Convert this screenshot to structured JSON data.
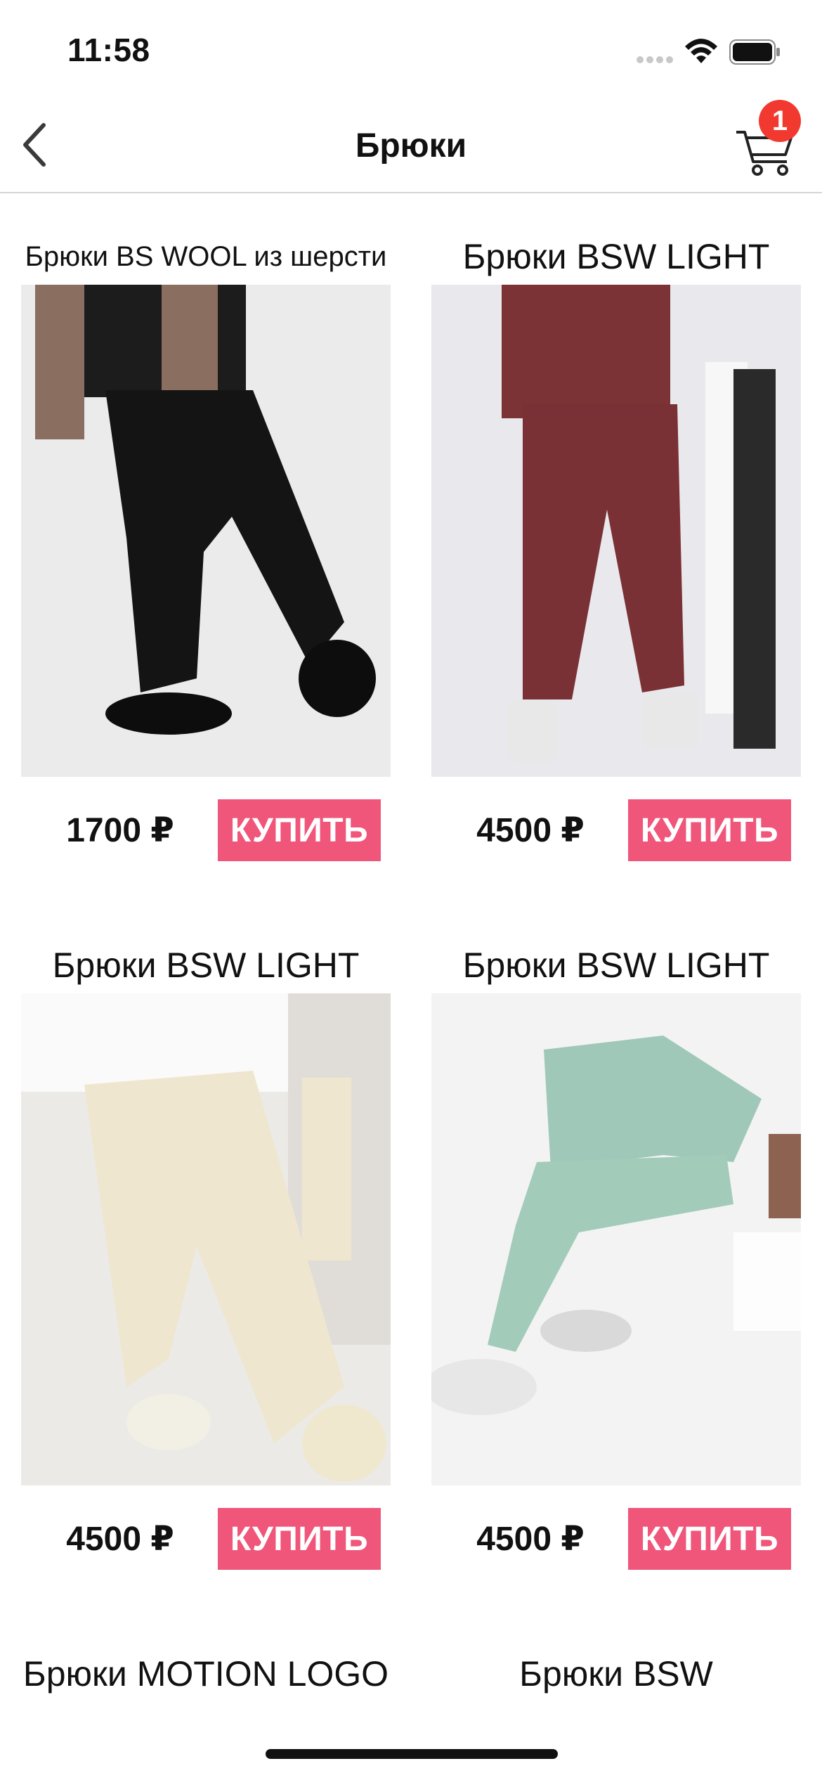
{
  "status_bar": {
    "time": "11:58"
  },
  "nav": {
    "title": "Брюки",
    "cart_count": "1"
  },
  "products": [
    {
      "title": "Брюки BS WOOL из шерсти",
      "price": "1700 ₽",
      "buy_label": "КУПИТЬ",
      "image": "black-wool-pants-photo"
    },
    {
      "title": "Брюки BSW LIGHT",
      "price": "4500 ₽",
      "buy_label": "КУПИТЬ",
      "image": "burgundy-pants-photo"
    },
    {
      "title": "Брюки BSW LIGHT",
      "price": "4500 ₽",
      "buy_label": "КУПИТЬ",
      "image": "cream-pants-photo"
    },
    {
      "title": "Брюки BSW LIGHT",
      "price": "4500 ₽",
      "buy_label": "КУПИТЬ",
      "image": "mint-pants-photo"
    },
    {
      "title": "Брюки MOTION LOGO"
    },
    {
      "title": "Брюки BSW"
    }
  ],
  "colors": {
    "accent": "#f0557a",
    "badge": "#f2392f"
  }
}
